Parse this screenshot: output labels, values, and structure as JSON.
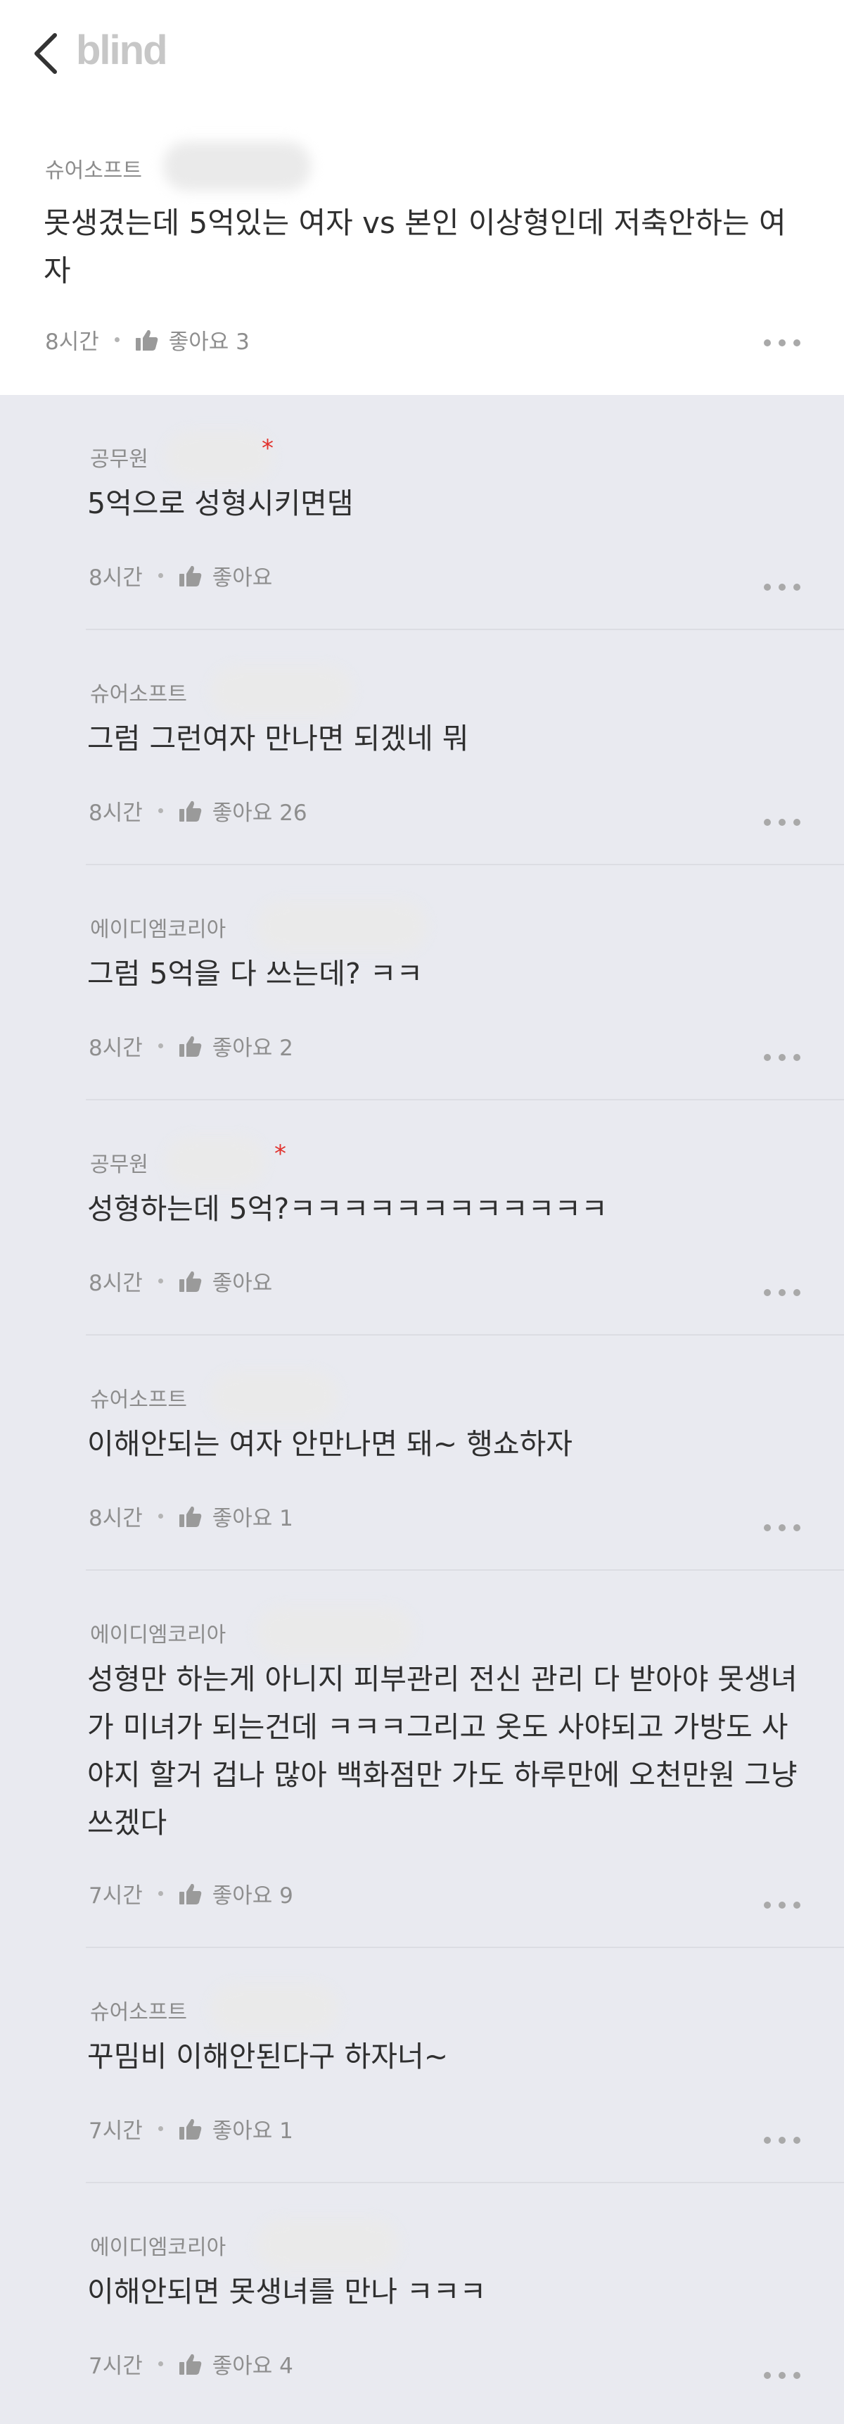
{
  "header": {
    "logo": "blind"
  },
  "post": {
    "company": "슈어소프트",
    "title": "못생겼는데 5억있는 여자 vs 본인 이상형인데 저축안하는 여자",
    "time": "8시간",
    "likes": "좋아요 3"
  },
  "comments": [
    {
      "company": "공무원",
      "badge": "*",
      "text": "5억으로 성형시키면댐",
      "time": "8시간",
      "likes": "좋아요"
    },
    {
      "company": "슈어소프트",
      "text": "그럼 그런여자 만나면 되겠네 뭐",
      "time": "8시간",
      "likes": "좋아요 26"
    },
    {
      "company": "에이디엠코리아",
      "text": "그럼 5억을 다 쓰는데? ㅋㅋ",
      "time": "8시간",
      "likes": "좋아요 2"
    },
    {
      "company": "공무원",
      "badge": "*",
      "text": "성형하는데 5억?ㅋㅋㅋㅋㅋㅋㅋㅋㅋㅋㅋㅋ",
      "time": "8시간",
      "likes": "좋아요"
    },
    {
      "company": "슈어소프트",
      "text": "이해안되는 여자 안만나면 돼~ 행쇼하자",
      "time": "8시간",
      "likes": "좋아요 1"
    },
    {
      "company": "에이디엠코리아",
      "text": "성형만 하는게 아니지 피부관리 전신 관리 다 받아야 못생녀가 미녀가 되는건데 ㅋㅋㅋ그리고 옷도 사야되고 가방도 사야지 할거 겁나 많아 백화점만 가도 하루만에 오천만원 그냥 쓰겠다",
      "time": "7시간",
      "likes": "좋아요 9"
    },
    {
      "company": "슈어소프트",
      "text": "꾸밈비 이해안된다구 하자너~",
      "time": "7시간",
      "likes": "좋아요 1"
    },
    {
      "company": "에이디엠코리아",
      "text": "이해안되면 못생녀를 만나 ㅋㅋㅋ",
      "time": "7시간",
      "likes": "좋아요 4"
    }
  ]
}
